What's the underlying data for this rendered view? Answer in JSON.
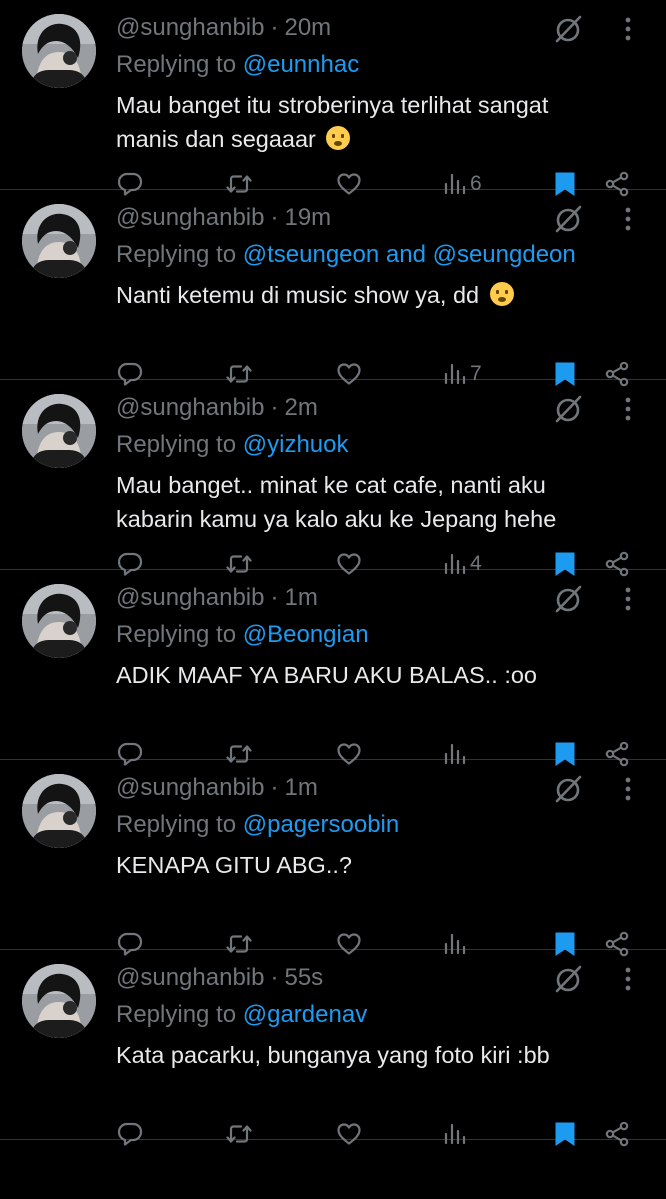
{
  "tweets": [
    {
      "handle": "@sunghanbib",
      "sep": "·",
      "time": "20m",
      "replying_prefix": "Replying to ",
      "replying_to": "@eunnhac",
      "text": "Mau banget itu stroberinya terlihat sangat manis dan segaaar",
      "emoji": "surprised-face",
      "views": "6"
    },
    {
      "handle": "@sunghanbib",
      "sep": "·",
      "time": "19m",
      "replying_prefix": "Replying to ",
      "replying_to": "@tseungeon and @seungdeon",
      "text": "Nanti ketemu di music show ya, dd",
      "emoji": "pleading-face",
      "views": "7"
    },
    {
      "handle": "@sunghanbib",
      "sep": "·",
      "time": "2m",
      "replying_prefix": "Replying to ",
      "replying_to": "@yizhuok",
      "text": "Mau banget.. minat ke cat cafe, nanti aku kabarin kamu ya kalo aku ke Jepang hehe",
      "emoji": "",
      "views": "4"
    },
    {
      "handle": "@sunghanbib",
      "sep": "·",
      "time": "1m",
      "replying_prefix": "Replying to ",
      "replying_to": "@Beongian",
      "text": "ADIK MAAF YA BARU AKU BALAS.. :oo",
      "emoji": "",
      "views": ""
    },
    {
      "handle": "@sunghanbib",
      "sep": "·",
      "time": "1m",
      "replying_prefix": "Replying to ",
      "replying_to": "@pagersoobin",
      "text": "KENAPA GITU ABG..?",
      "emoji": "",
      "views": ""
    },
    {
      "handle": "@sunghanbib",
      "sep": "·",
      "time": "55s",
      "replying_prefix": "Replying to ",
      "replying_to": "@gardenav",
      "text": "Kata pacarku, bunganya yang foto kiri :bb",
      "emoji": "",
      "views": ""
    }
  ],
  "icons": {
    "reply": "reply-icon",
    "retweet": "retweet-icon",
    "like": "heart-icon",
    "views": "views-icon",
    "bookmark": "bookmark-icon",
    "share": "share-icon",
    "muted": "muted-icon",
    "more": "more-icon"
  },
  "colors": {
    "background": "#000000",
    "text": "#e7e9ea",
    "secondary": "#71767b",
    "accent": "#1d9bf0",
    "divider": "#2f3336"
  }
}
